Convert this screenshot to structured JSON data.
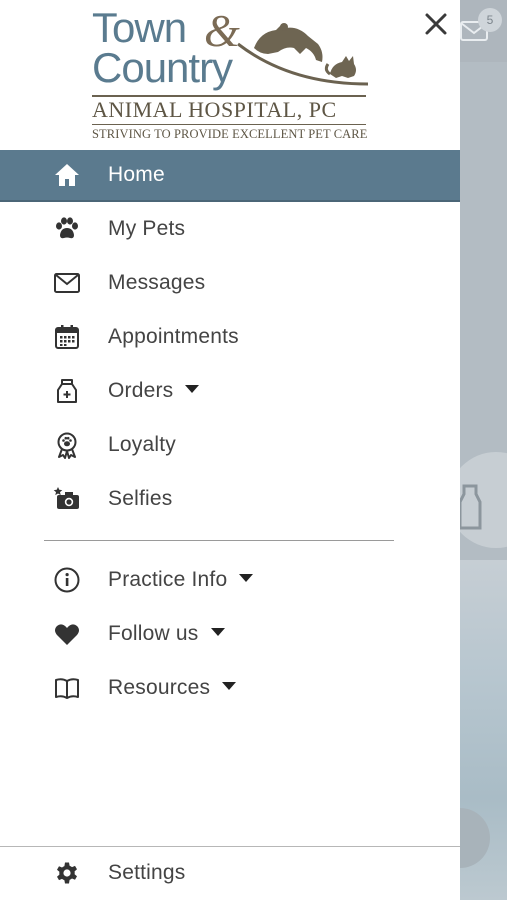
{
  "logo": {
    "line1": "Town",
    "ampersand": "&",
    "line2": "Country",
    "hospital": "ANIMAL HOSPITAL, PC",
    "tagline": "STRIVING TO PROVIDE EXCELLENT PET CARE"
  },
  "close_icon": "close-icon",
  "menu": [
    {
      "label": "Home",
      "icon": "home-icon",
      "active": true,
      "dropdown": false
    },
    {
      "label": "My Pets",
      "icon": "paw-icon",
      "active": false,
      "dropdown": false
    },
    {
      "label": "Messages",
      "icon": "envelope-icon",
      "active": false,
      "dropdown": false
    },
    {
      "label": "Appointments",
      "icon": "calendar-icon",
      "active": false,
      "dropdown": false
    },
    {
      "label": "Orders",
      "icon": "pet-food-bag-icon",
      "active": false,
      "dropdown": true
    },
    {
      "label": "Loyalty",
      "icon": "paw-award-ribbon-icon",
      "active": false,
      "dropdown": false
    },
    {
      "label": "Selfies",
      "icon": "camera-star-icon",
      "active": false,
      "dropdown": false
    }
  ],
  "secondary_menu": [
    {
      "label": "Practice Info",
      "icon": "info-icon",
      "dropdown": true
    },
    {
      "label": "Follow us",
      "icon": "heart-icon",
      "dropdown": true
    },
    {
      "label": "Resources",
      "icon": "book-icon",
      "dropdown": true
    }
  ],
  "settings": {
    "label": "Settings",
    "icon": "gear-icon"
  },
  "background": {
    "mail_badge_count": "5"
  },
  "colors": {
    "accent": "#5b7a8e",
    "logo_blue": "#5a7b8f",
    "logo_brown": "#7b6b55"
  }
}
